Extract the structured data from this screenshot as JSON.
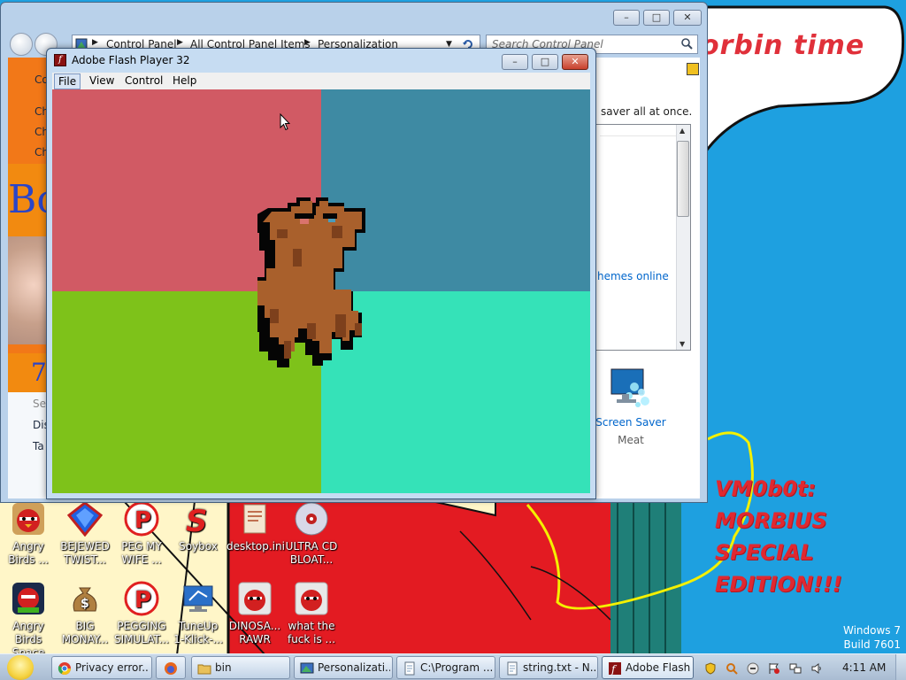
{
  "wallpaper": {
    "top_text": "orbin  time",
    "edition_lines": [
      "VM0b0t:",
      "MORBIUS",
      "SPECIAL",
      "EDITION!!!"
    ],
    "os_name": "Windows 7",
    "os_build": "Build 7601"
  },
  "desktop_icons": [
    {
      "label_1": "Angry",
      "label_2": "Birds ..."
    },
    {
      "label_1": "BEJEWED",
      "label_2": "TWIST..."
    },
    {
      "label_1": "PEG MY",
      "label_2": "WIFE ..."
    },
    {
      "label_1": "Soybox",
      "label_2": ""
    },
    {
      "label_1": "desktop.ini",
      "label_2": ""
    },
    {
      "label_1": "ULTRA CD",
      "label_2": "BLOAT..."
    },
    {
      "label_1": "Angry",
      "label_2": "Birds Space"
    },
    {
      "label_1": "BIG",
      "label_2": "MONAY..."
    },
    {
      "label_1": "PEGGING",
      "label_2": "SIMULAT..."
    },
    {
      "label_1": "TuneUp",
      "label_2": "1-Klick-..."
    },
    {
      "label_1": "DINOSA...",
      "label_2": "RAWR"
    },
    {
      "label_1": "what the",
      "label_2": "fuck is ..."
    }
  ],
  "control_panel": {
    "breadcrumbs": [
      "Control Panel",
      "All Control Panel Items",
      "Personalization"
    ],
    "search_placeholder": "Search Control Panel",
    "left_items": [
      "Co",
      "Ch",
      "Ch",
      "Ch"
    ],
    "left_banner_text": "Bo",
    "left_number": "7",
    "left_bottom_items": [
      "Se",
      "Dis",
      "Ta"
    ],
    "description_text": "saver all at once.",
    "themes_link": "hemes online",
    "screen_saver_label": "Screen Saver",
    "screen_saver_value": "Meat"
  },
  "flash_player": {
    "title": "Adobe Flash Player 32",
    "title_icon": "f",
    "menu": [
      "File",
      "View",
      "Control",
      "Help"
    ],
    "quadrant_colors": {
      "top_left": "#d15a64",
      "top_right": "#3e8aa3",
      "bottom_left": "#7ec21a",
      "bottom_right": "#35e2b8"
    },
    "sprite_colors": {
      "body": "#a9602c",
      "shade": "#7d401c",
      "outline": "#050505"
    }
  },
  "taskbar": {
    "buttons": [
      {
        "label": "Privacy error...",
        "icon": "chrome-icon"
      },
      {
        "label": "",
        "icon": "firefox-icon"
      },
      {
        "label": "bin",
        "icon": "folder-icon"
      },
      {
        "label": "Personalizati...",
        "icon": "control-panel-icon"
      },
      {
        "label": "C:\\Program ...",
        "icon": "notepad-icon"
      },
      {
        "label": "string.txt - N...",
        "icon": "notepad-icon"
      },
      {
        "label": "Adobe Flash...",
        "icon": "flash-icon"
      }
    ],
    "clock": "4:11 AM"
  },
  "colors": {
    "desktop_blue": "#1ea0e0",
    "wall_red": "#e0303a",
    "link_blue": "#0066cc"
  }
}
